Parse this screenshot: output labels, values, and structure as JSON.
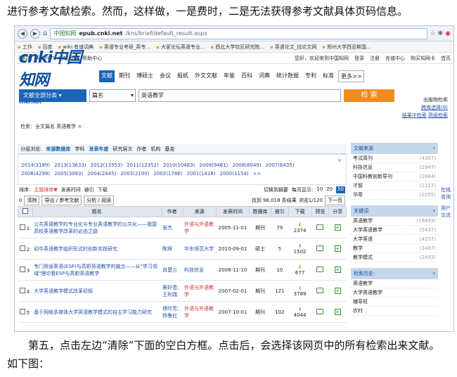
{
  "doc": {
    "top_text": "进行参考文献检索。然而，这样做，一是费时，二是无法获得参考文献具体页码信息。",
    "bottom_text": "第五，点击左边“清除”下面的空白方框。点击后，会选择该网页中的所有检索出来文献。如下图："
  },
  "browser": {
    "domain": "中国知网",
    "url_host": "epub.cnki.net",
    "url_path": "/kns/brief/default_result.aspx",
    "bookmarks": [
      "工作",
      "百度",
      "wiki·有道词典",
      "英语专业考研_英专...",
      "大家论坛英语专业...",
      "西北大学校区研究院...",
      "英语论文_找论文网",
      "郑州大学西亚斯国..."
    ]
  },
  "site": {
    "lang_links": [
      "手机版",
      "English",
      "网站地图",
      "帮助中心"
    ],
    "user_links": [
      "您好，欢迎来到中国知网",
      "登录",
      "注册",
      "充值中心",
      "购买知网卡",
      "首页"
    ],
    "logo_text": "cnki中国知网",
    "logo_sub": "cnki.net",
    "categories": [
      "文献",
      "期刊",
      "博硕士",
      "会议",
      "报纸",
      "外文文献",
      "年鉴",
      "百科",
      "词典",
      "统计数据",
      "专利",
      "标准",
      "更多>>"
    ],
    "all_category": "文献全部分类",
    "search_field": "篇名",
    "search_query": "英语教学",
    "search_button": "检 索",
    "side_links": [
      "出版物检索",
      "跨库选择(9)",
      "结果中检索",
      "高级检索"
    ],
    "crumb": "检索：全文篇名 英语教学"
  },
  "grouping": {
    "label": "分组浏览:",
    "options": [
      "来源数据库",
      "学科",
      "发表年度",
      "研究层次",
      "作者",
      "机构",
      "基金"
    ],
    "years": [
      "2014(3189)",
      "2013(13633)",
      "2012(13553)",
      "2011(12352)",
      "2010(10483)",
      "2009(9461)",
      "2008(8049)",
      "2007(6435)",
      "2006(4299)",
      "2005(3093)",
      "2004(2445)",
      "2003(2190)",
      "2002(1786)",
      "2001(1418)",
      "2000(1154)",
      ">>"
    ],
    "close": "×"
  },
  "sort": {
    "label": "排序:",
    "options": [
      "主题排序▼",
      "发表时间",
      "被引",
      "下载"
    ],
    "switch": "切换到摘要",
    "per_page": "每页显示:",
    "sizes": [
      "10",
      "20",
      "50"
    ],
    "found": "找到 98,018 条结果",
    "page": "浏览1/120",
    "next": "下一页"
  },
  "tools": {
    "count": "0",
    "clear": "清除",
    "export": "导出 / 参考文献",
    "analyze": "分析 / 阅读"
  },
  "table": {
    "headers": [
      "",
      "题名",
      "作者",
      "来源",
      "发表时间",
      "数据库",
      "被引",
      "下载",
      "预览",
      "分享"
    ],
    "rows": [
      {
        "no": "1",
        "title": "公共英语教学的专业化与专业英语教学的公共化——我国高校英语教学改革的必由之路",
        "author": "张杰",
        "source": "外语与外语教学",
        "date": "2005-11-01",
        "db": "期刊",
        "cited": "79",
        "downloads": "2374"
      },
      {
        "no": "2",
        "title": "初中英语教学组织形式的创新实践研究",
        "author": "陈辉",
        "source": "华东师范大学",
        "date": "2010-09-01",
        "db": "硕士",
        "cited": "5",
        "downloads": "1502"
      },
      {
        "no": "3",
        "title": "专门用途英语(ESP)与高职英语教学的融合——从\"学习领域\"理论看ESP与高职英语教学",
        "author": "肖楚兰",
        "source": "科技信息",
        "date": "2008-11-10",
        "db": "期刊",
        "cited": "10",
        "downloads": "677"
      },
      {
        "no": "4",
        "title": "大学英语教学模式改革初探",
        "author": "蔡好音;王利瑞",
        "source": "外语与外语教学",
        "date": "2007-02-01",
        "db": "期刊",
        "cited": "121",
        "downloads": "3789"
      },
      {
        "no": "5",
        "title": "基于网络多媒体大学英语教学模式的自主学习能力研究",
        "author": "傅玲芳;杨鲁红",
        "source": "外语与外语教学",
        "date": "2007-10-01",
        "db": "期刊",
        "cited": "102",
        "downloads": "4044"
      }
    ]
  },
  "sidebar": {
    "source_title": "文献来源",
    "sources": [
      {
        "name": "考试周刊",
        "count": "(4307)"
      },
      {
        "name": "科技信息",
        "count": "(1947)"
      },
      {
        "name": "中国科教创新导刊",
        "count": "(1684)"
      },
      {
        "name": "才智",
        "count": "(1117)"
      },
      {
        "name": "华章",
        "count": "(1055)"
      }
    ],
    "keyword_title": "关键词",
    "keywords": [
      {
        "name": "英语教学",
        "count": "(19493)"
      },
      {
        "name": "大学英语教学",
        "count": "(5437)"
      },
      {
        "name": "大学英语",
        "count": "(4157)"
      },
      {
        "name": "教学",
        "count": "(3487)"
      },
      {
        "name": "教学模式",
        "count": "(2493)"
      }
    ],
    "history_title": "检索历史:",
    "history": [
      "英语教学",
      "大学英语教学",
      "辅导班",
      "农村"
    ],
    "edge": [
      "在线",
      "咨询",
      "用户",
      "交流"
    ]
  }
}
